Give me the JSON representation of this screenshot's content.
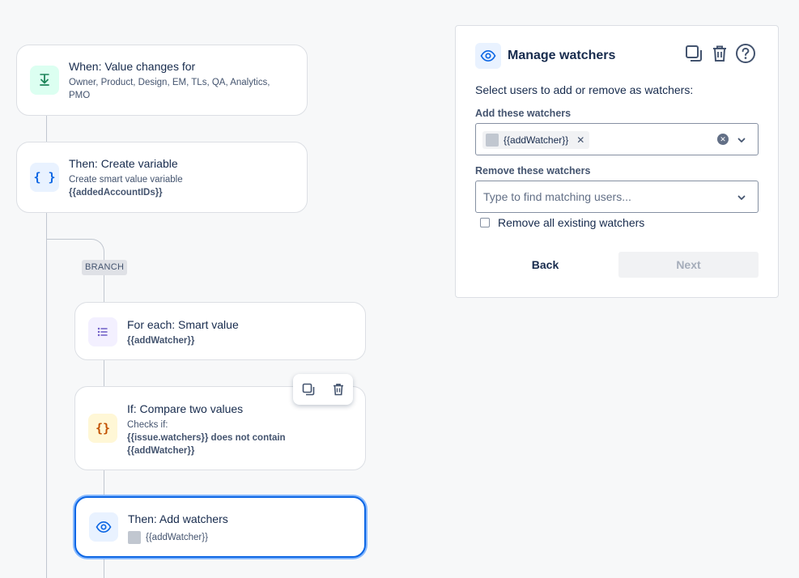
{
  "flow": {
    "trigger": {
      "title": "When: Value changes for",
      "subtitle": "Owner, Product, Design, EM, TLs, QA, Analytics, PMO"
    },
    "create_variable": {
      "title": "Then: Create variable",
      "subtitle": "Create smart value variable",
      "value": "{{addedAccountIDs}}"
    },
    "branch_label": "BRANCH",
    "for_each": {
      "title": "For each: Smart value",
      "value": "{{addWatcher}}"
    },
    "condition": {
      "title": "If: Compare two values",
      "subtitle": "Checks if:",
      "expr_line1": "{{issue.watchers}} does not contain",
      "expr_line2": "{{addWatcher}}"
    },
    "add_watchers": {
      "title": "Then: Add watchers",
      "value": "{{addWatcher}}"
    }
  },
  "panel": {
    "title": "Manage watchers",
    "description": "Select users to add or remove as watchers:",
    "add_label": "Add these watchers",
    "add_tag": "{{addWatcher}}",
    "remove_label": "Remove these watchers",
    "remove_placeholder": "Type to find matching users...",
    "remove_all_label": "Remove all existing watchers",
    "back_label": "Back",
    "next_label": "Next"
  },
  "colors": {
    "accent": "#0c66e4",
    "green_bg": "#dcfff1",
    "green": "#1f845a",
    "blue_bg": "#e9f2ff",
    "purple_bg": "#f3f0ff",
    "purple": "#6e5dc6",
    "orange_bg": "#fff7d6",
    "orange": "#c25100"
  }
}
